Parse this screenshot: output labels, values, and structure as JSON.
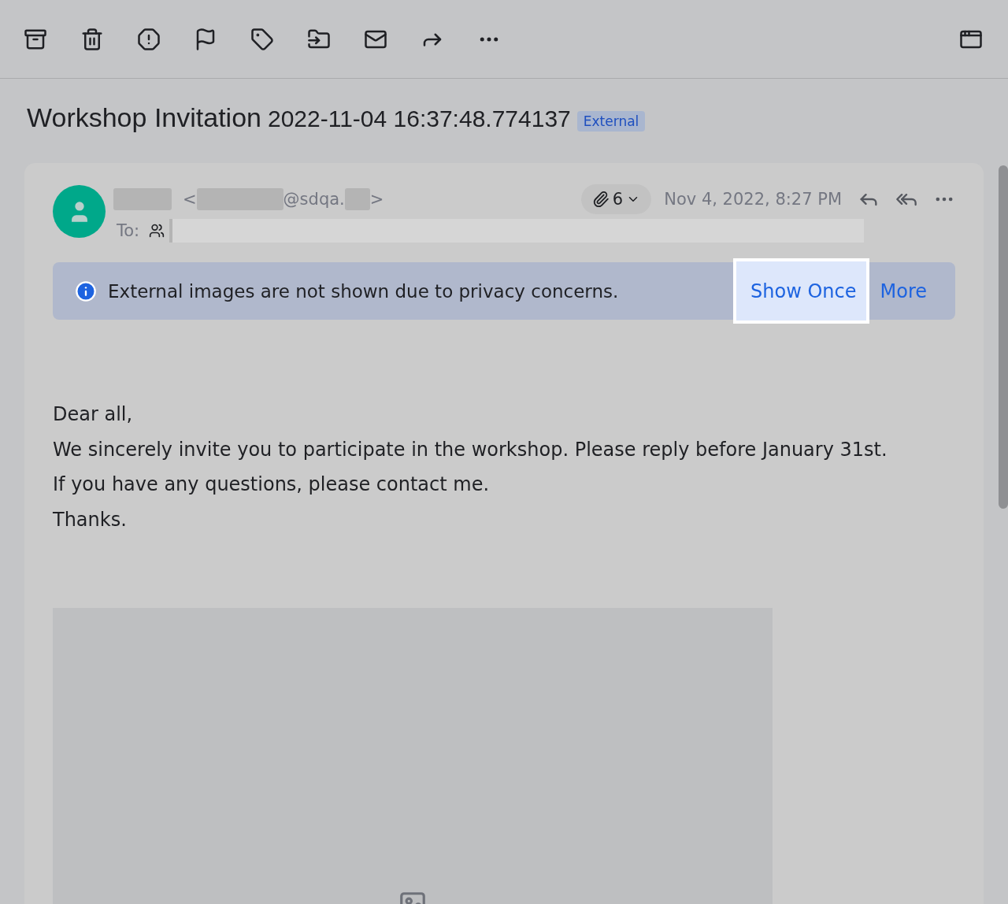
{
  "toolbar": {
    "buttons": [
      {
        "kind": "archive"
      },
      {
        "kind": "trash"
      },
      {
        "kind": "spam"
      },
      {
        "kind": "flag"
      },
      {
        "kind": "tag"
      },
      {
        "kind": "move"
      },
      {
        "kind": "unread"
      },
      {
        "kind": "forward"
      },
      {
        "kind": "more"
      }
    ],
    "right_button": {
      "kind": "window"
    }
  },
  "subject": {
    "title": "Workshop Invitation",
    "timestamp": "2022-11-04 16:37:48.774137",
    "badge": "External"
  },
  "message": {
    "sender": {
      "open": "<",
      "domain": "@sdqa.",
      "close": ">"
    },
    "to_label": "To:",
    "attachments": "6",
    "date": "Nov 4, 2022, 8:27 PM",
    "notice": {
      "text": "External images are not shown due to privacy concerns.",
      "actions": [
        {
          "label": "Show Once",
          "highlighted": true
        },
        {
          "label": "More",
          "highlighted": false
        }
      ]
    },
    "body": [
      "Dear all,",
      "We sincerely invite you to participate in the workshop. Please reply before January 31st.",
      "If you have any questions, please contact me.",
      "Thanks."
    ]
  }
}
